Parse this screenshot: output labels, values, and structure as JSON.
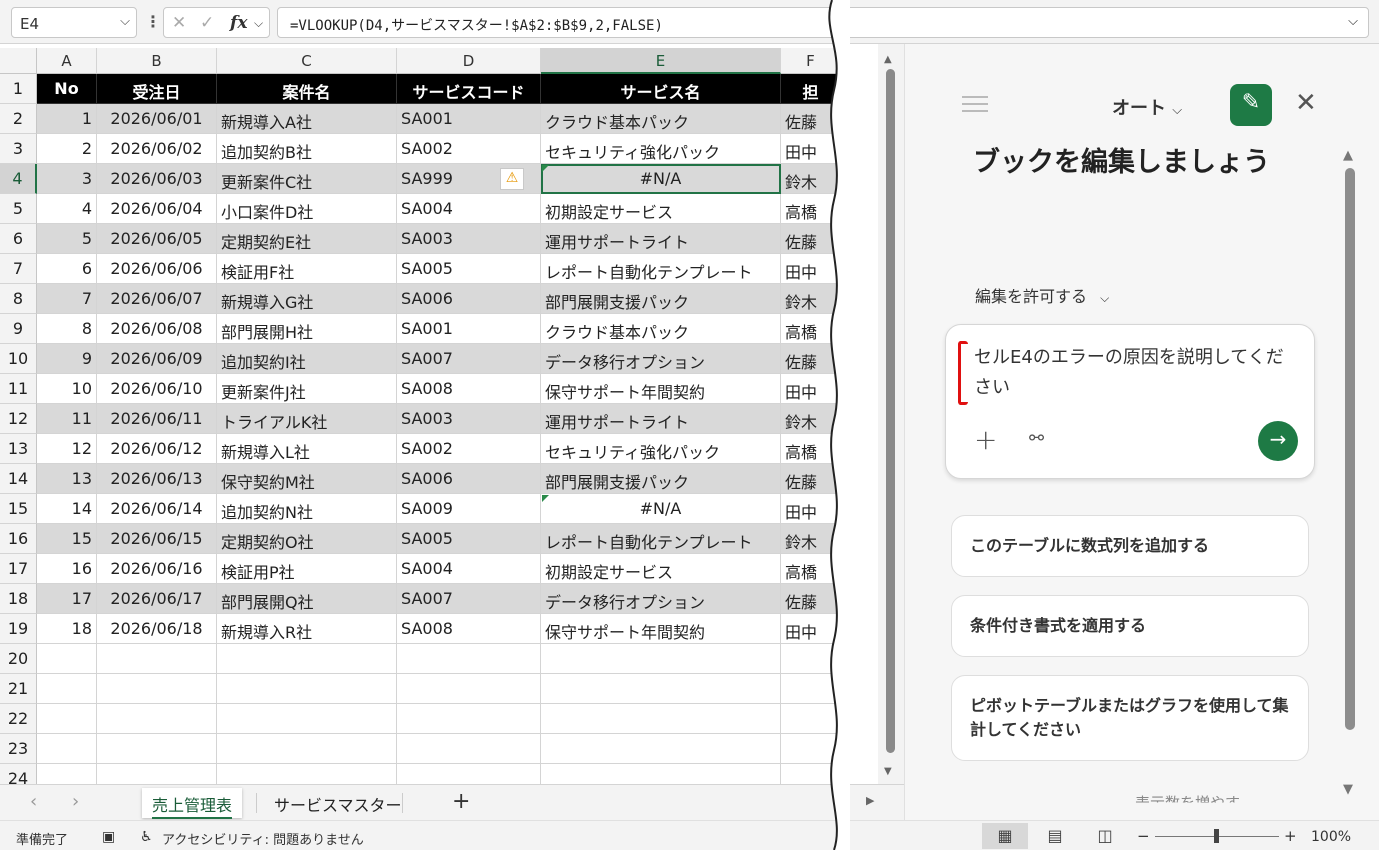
{
  "formula_bar": {
    "name_box": "E4",
    "formula": "=VLOOKUP(D4,サービスマスター!$A$2:$B$9,2,FALSE)",
    "cancel_icon": "✕",
    "enter_icon": "✓",
    "fx_label": "fx"
  },
  "columns": [
    "A",
    "B",
    "C",
    "D",
    "E",
    "F"
  ],
  "row_numbers": [
    "1",
    "2",
    "3",
    "4",
    "5",
    "6",
    "7",
    "8",
    "9",
    "10",
    "11",
    "12",
    "13",
    "14",
    "15",
    "16",
    "17",
    "18",
    "19",
    "20",
    "21",
    "22",
    "23",
    "24"
  ],
  "table_headers": [
    "No",
    "受注日",
    "案件名",
    "サービスコード",
    "サービス名",
    "担"
  ],
  "rows": [
    [
      "1",
      "2026/06/01",
      "新規導入A社",
      "SA001",
      "クラウド基本パック",
      "佐藤"
    ],
    [
      "2",
      "2026/06/02",
      "追加契約B社",
      "SA002",
      "セキュリティ強化パック",
      "田中"
    ],
    [
      "3",
      "2026/06/03",
      "更新案件C社",
      "SA999",
      "#N/A",
      "鈴木"
    ],
    [
      "4",
      "2026/06/04",
      "小口案件D社",
      "SA004",
      "初期設定サービス",
      "高橋"
    ],
    [
      "5",
      "2026/06/05",
      "定期契約E社",
      "SA003",
      "運用サポートライト",
      "佐藤"
    ],
    [
      "6",
      "2026/06/06",
      "検証用F社",
      "SA005",
      "レポート自動化テンプレート",
      "田中"
    ],
    [
      "7",
      "2026/06/07",
      "新規導入G社",
      "SA006",
      "部門展開支援パック",
      "鈴木"
    ],
    [
      "8",
      "2026/06/08",
      "部門展開H社",
      "SA001",
      "クラウド基本パック",
      "高橋"
    ],
    [
      "9",
      "2026/06/09",
      "追加契約I社",
      "SA007",
      "データ移行オプション",
      "佐藤"
    ],
    [
      "10",
      "2026/06/10",
      "更新案件J社",
      "SA008",
      "保守サポート年間契約",
      "田中"
    ],
    [
      "11",
      "2026/06/11",
      "トライアルK社",
      "SA003",
      "運用サポートライト",
      "鈴木"
    ],
    [
      "12",
      "2026/06/12",
      "新規導入L社",
      "SA002",
      "セキュリティ強化パック",
      "高橋"
    ],
    [
      "13",
      "2026/06/13",
      "保守契約M社",
      "SA006",
      "部門展開支援パック",
      "佐藤"
    ],
    [
      "14",
      "2026/06/14",
      "追加契約N社",
      "SA009",
      "#N/A",
      "田中"
    ],
    [
      "15",
      "2026/06/15",
      "定期契約O社",
      "SA005",
      "レポート自動化テンプレート",
      "鈴木"
    ],
    [
      "16",
      "2026/06/16",
      "検証用P社",
      "SA004",
      "初期設定サービス",
      "高橋"
    ],
    [
      "17",
      "2026/06/17",
      "部門展開Q社",
      "SA007",
      "データ移行オプション",
      "佐藤"
    ],
    [
      "18",
      "2026/06/18",
      "新規導入R社",
      "SA008",
      "保守サポート年間契約",
      "田中"
    ]
  ],
  "warning_icon": "⚠",
  "sheet_tabs": [
    "売上管理表",
    "サービスマスター"
  ],
  "add_sheet": "+",
  "status_bar": {
    "ready": "準備完了",
    "accessibility": "アクセシビリティ: 問題ありません",
    "zoom_minus": "−",
    "zoom_plus": "+",
    "zoom": "100%"
  },
  "copilot": {
    "mode": "オート",
    "title": "ブックを編集しましょう",
    "permission": "編集を許可する",
    "prompt": "セルE4のエラーの原因を説明してください",
    "suggestions": [
      "このテーブルに数式列を追加する",
      "条件付き書式を適用する",
      "ピボットテーブルまたはグラフを使用して集計してください"
    ],
    "more": "表示数を増やす"
  },
  "colors": {
    "accent": "#217346",
    "copilot_green": "#1e7a45",
    "shade": "#d9d9d9",
    "header": "#000000"
  },
  "icons": [
    "chevron-down-icon",
    "close-icon",
    "check-icon",
    "fx-icon",
    "warning-icon",
    "hamburger-icon",
    "new-chat-icon",
    "plus-icon",
    "link-icon",
    "send-arrow-icon",
    "normal-view-icon",
    "page-layout-icon",
    "page-break-icon"
  ]
}
